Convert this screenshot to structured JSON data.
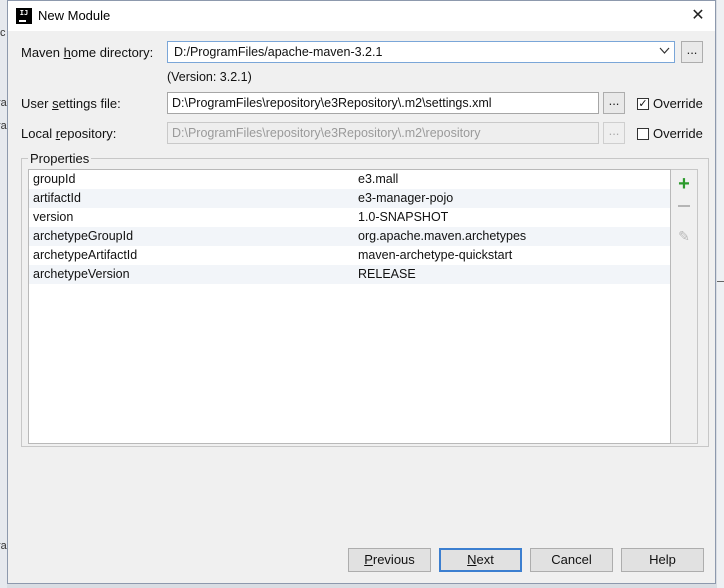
{
  "window": {
    "title": "New Module",
    "app_icon_text": "IJ",
    "close_symbol": "✕"
  },
  "background": {
    "left_strip_glyphs": [
      "ıc",
      "ra",
      "ra",
      "ra"
    ]
  },
  "maven_home": {
    "label_pre": "Maven ",
    "label_mnemonic": "h",
    "label_post": "ome directory:",
    "value": "D:/ProgramFiles/apache-maven-3.2.1",
    "dropdown_icon": "chevron-down-icon",
    "browse_label": "...",
    "version_text": "(Version: 3.2.1)"
  },
  "user_settings": {
    "label_pre": "User ",
    "label_mnemonic": "s",
    "label_post": "ettings file:",
    "value": "D:\\ProgramFiles\\repository\\e3Repository\\.m2\\settings.xml",
    "browse_label": "...",
    "override_label": "Override",
    "override_checked": true,
    "check_mark": "✓"
  },
  "local_repository": {
    "label_pre": "Local ",
    "label_mnemonic": "r",
    "label_post": "epository:",
    "value": "D:\\ProgramFiles\\repository\\e3Repository\\.m2\\repository",
    "browse_label": "...",
    "override_label": "Override",
    "override_checked": false,
    "disabled": true
  },
  "properties": {
    "group_title": "Properties",
    "rows": [
      {
        "key": "groupId",
        "value": "e3.mall"
      },
      {
        "key": "artifactId",
        "value": "e3-manager-pojo"
      },
      {
        "key": "version",
        "value": "1.0-SNAPSHOT"
      },
      {
        "key": "archetypeGroupId",
        "value": "org.apache.maven.archetypes"
      },
      {
        "key": "archetypeArtifactId",
        "value": "maven-archetype-quickstart"
      },
      {
        "key": "archetypeVersion",
        "value": "RELEASE"
      }
    ],
    "tools": {
      "add_symbol": "+",
      "edit_symbol": "✎"
    }
  },
  "footer": {
    "previous_label_mnemonic": "P",
    "previous_label_rest": "revious",
    "next_label_mnemonic": "N",
    "next_label_rest": "ext",
    "cancel_label": "Cancel",
    "help_label": "Help"
  },
  "colors": {
    "accent": "#3c7fd0",
    "add_green": "#2c9a2c"
  }
}
